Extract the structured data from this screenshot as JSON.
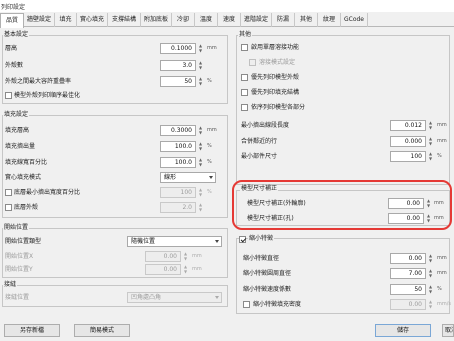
{
  "window": {
    "title": "列印設定"
  },
  "tabs": [
    {
      "label": "品質"
    },
    {
      "label": "牆壁設定"
    },
    {
      "label": "填充"
    },
    {
      "label": "實心填充"
    },
    {
      "label": "支撐結構"
    },
    {
      "label": "附加底板"
    },
    {
      "label": "冷卻"
    },
    {
      "label": "溫度"
    },
    {
      "label": "速度"
    },
    {
      "label": "進階設定"
    },
    {
      "label": "防漏"
    },
    {
      "label": "其他"
    },
    {
      "label": "紋理"
    },
    {
      "label": "GCode"
    }
  ],
  "left": {
    "basic": {
      "title": "基本設定",
      "layer_height_label": "層高",
      "layer_height": "0.1000",
      "shell_label": "外殼數",
      "shell_value": "3.0",
      "overlap_label": "外殼之間最大容許重疊率",
      "overlap_value": "50",
      "optimize_label": "模型外殼列印順序最佳化"
    },
    "fill": {
      "title": "填充設定",
      "layer_label": "填充層高",
      "layer_value": "0.3000",
      "flow_label": "填充擠出量",
      "flow_value": "100.0",
      "width_label": "填充線寬百分比",
      "width_value": "100.0",
      "pattern_label": "實心填充模式",
      "pattern_value": "線形",
      "gap_label": "底層最小擠出寬度百分比",
      "gap_value": "100",
      "outer_label": "底層外殼",
      "outer_value": "2.0"
    },
    "start": {
      "title": "開始位置",
      "method_label": "開始位置類型",
      "method_value": "隨機位置",
      "x_label": "開始位置X",
      "x_value": "0.00",
      "y_label": "開始位置Y",
      "y_value": "0.00"
    },
    "seam": {
      "title": "接縫",
      "corner_label": "接縫位置",
      "corner_value": "凹角處凸角"
    }
  },
  "right": {
    "misc": {
      "title": "其他",
      "items": [
        {
          "label": "啟用單層溶接功能",
          "checked": false,
          "dim": false
        },
        {
          "label": "溶接模式設定",
          "checked": false,
          "dim": true
        },
        {
          "label": "優先列印模型外殼",
          "checked": false,
          "dim": false
        },
        {
          "label": "優先列印填充結構",
          "checked": false,
          "dim": false
        },
        {
          "label": "依序列印模型各部分",
          "checked": false,
          "dim": false
        }
      ],
      "min_extrude_label": "最小擠出線段長度",
      "min_extrude_value": "0.012",
      "merge_label": "合併鄰近的行",
      "merge_value": "0.000",
      "min_part_label": "最小部件尺寸",
      "min_part_value": "100"
    },
    "size": {
      "title": "模型尺寸補正",
      "outer_label": "模型尺寸補正(外輪廓)",
      "outer_value": "0.00",
      "hole_label": "模型尺寸補正(孔)",
      "hole_value": "0.00"
    },
    "small": {
      "title": "縮小特徵",
      "checked": true,
      "threshold_label": "縮小特徵直徑",
      "threshold_value": "0.00",
      "radius_label": "縮小特徵圓周直徑",
      "radius_value": "7.00",
      "speed_label": "縮小特徵速度係數",
      "speed_value": "50",
      "slow_label": "縮小特徵填充密度",
      "slow_value": "0.00"
    }
  },
  "units": {
    "mm": "mm",
    "pct": "%",
    "mms": "mm/s"
  },
  "buttons": {
    "save_as": "另存新檔",
    "easy": "簡易模式",
    "save": "儲存",
    "cancel": "取消"
  }
}
